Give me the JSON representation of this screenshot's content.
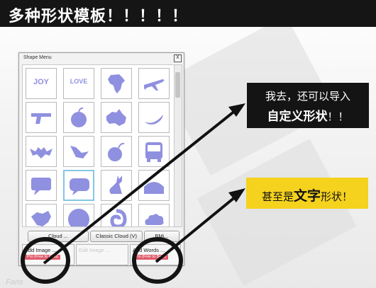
{
  "header": {
    "title": "多种形状模板！！！！！"
  },
  "window": {
    "title": "Shape Menu",
    "close_glyph": "X"
  },
  "tiles": [
    {
      "kind": "text",
      "text": "JOY"
    },
    {
      "kind": "text",
      "text": "LOVE"
    },
    {
      "kind": "icon",
      "icon": "africa-icon"
    },
    {
      "kind": "icon",
      "icon": "airplane-icon"
    },
    {
      "kind": "icon",
      "icon": "gun-icon"
    },
    {
      "kind": "icon",
      "icon": "apple-icon"
    },
    {
      "kind": "icon",
      "icon": "australia-icon"
    },
    {
      "kind": "icon",
      "icon": "banana-icon"
    },
    {
      "kind": "icon",
      "icon": "bat-icon"
    },
    {
      "kind": "icon",
      "icon": "bird-icon"
    },
    {
      "kind": "icon",
      "icon": "bomb-icon"
    },
    {
      "kind": "icon",
      "icon": "bus-icon"
    },
    {
      "kind": "icon",
      "icon": "speech-bubble-icon"
    },
    {
      "kind": "icon",
      "icon": "speech-bubble-icon",
      "selected": true
    },
    {
      "kind": "icon",
      "icon": "cat-icon"
    },
    {
      "kind": "icon",
      "icon": "shape-icon"
    },
    {
      "kind": "icon",
      "icon": "china-map-icon"
    },
    {
      "kind": "icon",
      "icon": "circle-icon"
    },
    {
      "kind": "icon",
      "icon": "swirl-icon"
    },
    {
      "kind": "icon",
      "icon": "cloud-icon"
    }
  ],
  "buttons": {
    "cloud_left": "Cloud ...",
    "classic_cloud": "Classic Cloud (V)",
    "right_partial": "BMi..."
  },
  "add_image": {
    "label": "Add Image ...",
    "pill": "Pro (Free to Beta)"
  },
  "edit_image": {
    "label": "Edit Image ..."
  },
  "add_words": {
    "label": "Add Words ...",
    "pill": "Pro (Free to Beta)"
  },
  "callout_custom": {
    "line1": "我去，还可以导入",
    "line2_bold": "自定义形状",
    "line2_rest": "！！"
  },
  "callout_text": {
    "prefix": "甚至是",
    "bold": "文字",
    "suffix": "形状！"
  },
  "watermark": "Fans",
  "colors": {
    "shape": "#9090e0",
    "header_bg": "#151515",
    "callout_dark": "#141414",
    "callout_yellow": "#f5d21d",
    "selected_border": "#84c6e3"
  }
}
